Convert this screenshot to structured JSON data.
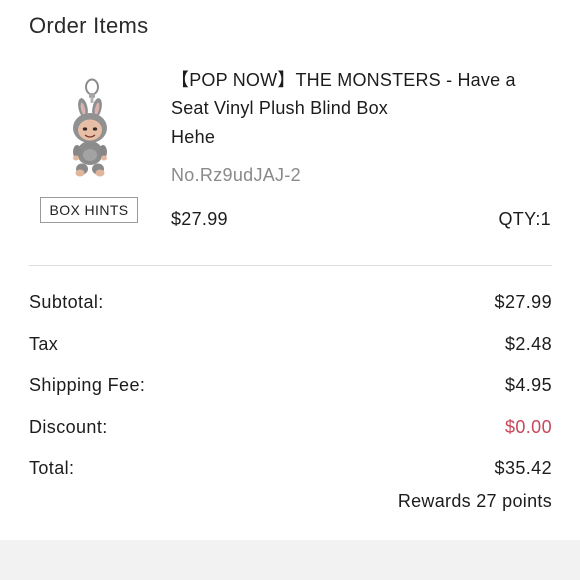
{
  "section": {
    "title": "Order Items"
  },
  "product": {
    "image_icon": "monster-plush-keychain-figure",
    "box_hints_label": "BOX HINTS",
    "name": "【POP NOW】THE MONSTERS - Have a Seat Vinyl Plush Blind Box",
    "variant": "Hehe",
    "sku": "No.Rz9udJAJ-2",
    "price": "$27.99",
    "qty": "QTY:1"
  },
  "summary": {
    "subtotal_label": "Subtotal:",
    "subtotal_value": "$27.99",
    "tax_label": "Tax",
    "tax_value": "$2.48",
    "shipping_label": "Shipping Fee:",
    "shipping_value": "$4.95",
    "discount_label": "Discount:",
    "discount_value": "$0.00",
    "total_label": "Total:",
    "total_value": "$35.42",
    "rewards": "Rewards 27 points"
  },
  "colors": {
    "discount": "#c8475a",
    "muted_text": "#8a8a8a",
    "divider": "#dcdcdc",
    "footer_band": "#f2f2f2"
  }
}
